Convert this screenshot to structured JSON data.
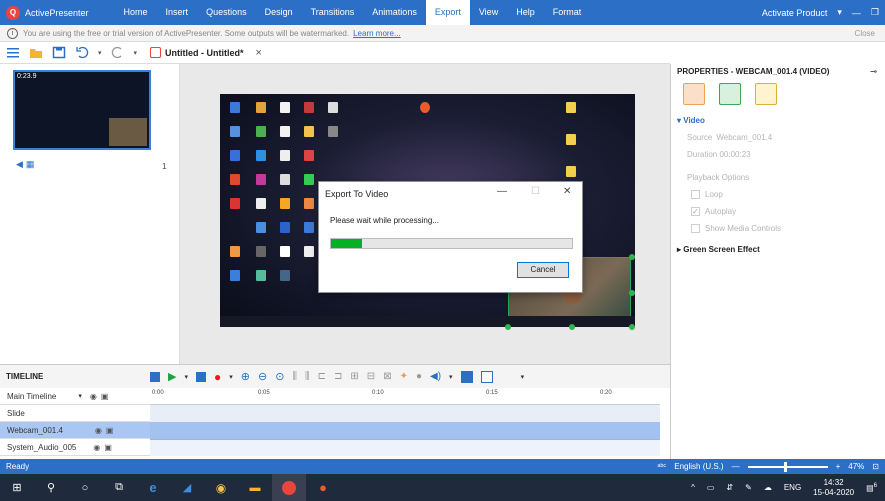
{
  "menubar": {
    "app_name": "ActivePresenter",
    "items": [
      "Home",
      "Insert",
      "Questions",
      "Design",
      "Transitions",
      "Animations",
      "Export",
      "View",
      "Help",
      "Format"
    ],
    "active_item": "Export",
    "activate": "Activate Product"
  },
  "notice": {
    "text": "You are using the free or trial version of ActivePresenter. Some outputs will be watermarked.",
    "link": "Learn more...",
    "close": "Close"
  },
  "toolbar": {
    "document_title": "Untitled - Untitled*"
  },
  "slides": {
    "thumb_duration": "0:23.9",
    "slide_number": "1"
  },
  "dialog": {
    "title": "Export To Video",
    "message": "Please wait while processing...",
    "progress_fraction": 0.13,
    "cancel_label": "Cancel"
  },
  "properties": {
    "header": "PROPERTIES - WEBCAM_001.4 (VIDEO)",
    "section": "Video",
    "source_label": "Source",
    "source_value": "Webcam_001.4",
    "duration": "Duration  00:00:23",
    "playback_label": "Playback Options",
    "loop": "Loop",
    "autoplay": "Autoplay",
    "show_controls": "Show Media Controls",
    "green_screen": "Green Screen Effect"
  },
  "timeline": {
    "label": "TIMELINE",
    "main_timeline": "Main Timeline",
    "ruler": [
      "0:00",
      "0:05",
      "0:10",
      "0:15",
      "0:20"
    ],
    "rows": [
      "Slide",
      "Webcam_001.4",
      "System_Audio_005"
    ]
  },
  "statusbar": {
    "status": "Ready",
    "language": "English (U.S.)",
    "zoom": "47%"
  },
  "taskbar": {
    "lang": "ENG",
    "time": "14:32",
    "date": "15-04-2020",
    "notif_count": "6"
  },
  "colors": {
    "accent": "#2b6fc7",
    "progress": "#06b025",
    "handle": "#2fb54e"
  }
}
